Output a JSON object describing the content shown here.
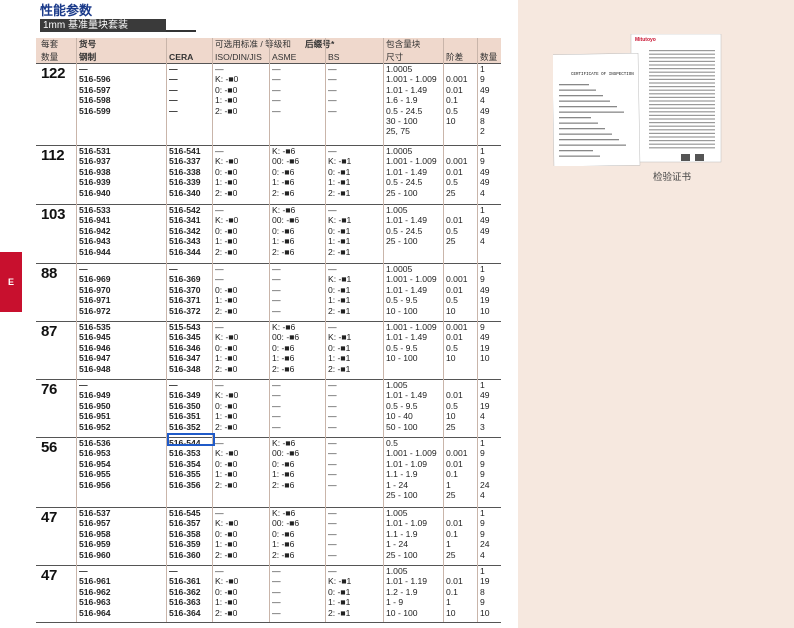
{
  "page": {
    "title": "性能参数",
    "subtitle": "1mm 基准量块套装",
    "tab_letter": "E",
    "cert_caption": "检验证书"
  },
  "colors": {
    "accent": "#c8102e",
    "title": "#1a3a8a",
    "side_bg": "#f6e8df",
    "header_bg": "#efd8cc",
    "highlight": "#1f5ac8"
  },
  "headers": {
    "top": [
      "每套",
      "货号",
      "可选用标准 / 等级和",
      "后缀号",
      "*",
      "包含量块"
    ],
    "bottom": [
      "数量",
      "钢制",
      "CERA",
      "ISO/DIN/JIS",
      "ASME",
      "BS",
      "尺寸",
      "阶差",
      "数量"
    ]
  },
  "groups": [
    {
      "qty": "122",
      "steel": [
        "—",
        "516-596",
        "516-597",
        "516-598",
        "516-599"
      ],
      "cera": [
        "—",
        "—",
        "—",
        "—",
        "—"
      ],
      "iso": [
        "—",
        "K: -■0",
        "0: -■0",
        "1: -■0",
        "2: -■0"
      ],
      "asme": [
        "—",
        "—",
        "—",
        "—",
        "—"
      ],
      "bs": [
        "—",
        "—",
        "—",
        "—",
        "—"
      ],
      "size": [
        "1.0005",
        "1.001 - 1.009",
        "1.01 - 1.49",
        "1.6 - 1.9",
        "0.5 - 24.5",
        "30 - 100",
        "25, 75"
      ],
      "step": [
        "",
        "0.001",
        "0.01",
        "0.1",
        "0.5",
        "10",
        ""
      ],
      "count": [
        "1",
        "9",
        "49",
        "4",
        "49",
        "8",
        "2"
      ]
    },
    {
      "qty": "112",
      "steel": [
        "516-531",
        "516-937",
        "516-938",
        "516-939",
        "516-940"
      ],
      "cera": [
        "516-541",
        "516-337",
        "516-338",
        "516-339",
        "516-340"
      ],
      "iso": [
        "—",
        "K: -■0",
        "0: -■0",
        "1: -■0",
        "2: -■0"
      ],
      "asme": [
        "K: -■6",
        "00: -■6",
        "0: -■6",
        "1: -■6",
        "2: -■6"
      ],
      "bs": [
        "—",
        "K: -■1",
        "0: -■1",
        "1: -■1",
        "2: -■1"
      ],
      "size": [
        "1.0005",
        "1.001 - 1.009",
        "1.01 - 1.49",
        "0.5 - 24.5",
        "25 - 100"
      ],
      "step": [
        "",
        "0.001",
        "0.01",
        "0.5",
        "25"
      ],
      "count": [
        "1",
        "9",
        "49",
        "49",
        "4"
      ]
    },
    {
      "qty": "103",
      "steel": [
        "516-533",
        "516-941",
        "516-942",
        "516-943",
        "516-944"
      ],
      "cera": [
        "516-542",
        "516-341",
        "516-342",
        "516-343",
        "516-344"
      ],
      "iso": [
        "—",
        "K: -■0",
        "0: -■0",
        "1: -■0",
        "2: -■0"
      ],
      "asme": [
        "K: -■6",
        "00: -■6",
        "0: -■6",
        "1: -■6",
        "2: -■6"
      ],
      "bs": [
        "—",
        "K: -■1",
        "0: -■1",
        "1: -■1",
        "2: -■1"
      ],
      "size": [
        "1.005",
        "1.01 - 1.49",
        "0.5 - 24.5",
        "25 - 100"
      ],
      "step": [
        "",
        "0.01",
        "0.5",
        "25"
      ],
      "count": [
        "1",
        "49",
        "49",
        "4"
      ]
    },
    {
      "qty": "88",
      "steel": [
        "—",
        "516-969",
        "516-970",
        "516-971",
        "516-972"
      ],
      "cera": [
        "—",
        "516-369",
        "516-370",
        "516-371",
        "516-372"
      ],
      "iso": [
        "—",
        "—",
        "0: -■0",
        "1: -■0",
        "2: -■0"
      ],
      "asme": [
        "—",
        "—",
        "—",
        "—",
        "—"
      ],
      "bs": [
        "—",
        "K: -■1",
        "0: -■1",
        "1: -■1",
        "2: -■1"
      ],
      "size": [
        "1.0005",
        "1.001 - 1.009",
        "1.01 - 1.49",
        "0.5 - 9.5",
        "10 - 100"
      ],
      "step": [
        "",
        "0.001",
        "0.01",
        "0.5",
        "10"
      ],
      "count": [
        "1",
        "9",
        "49",
        "19",
        "10"
      ]
    },
    {
      "qty": "87",
      "steel": [
        "516-535",
        "516-945",
        "516-946",
        "516-947",
        "516-948"
      ],
      "cera": [
        "515-543",
        "516-345",
        "516-346",
        "516-347",
        "516-348"
      ],
      "iso": [
        "—",
        "K: -■0",
        "0: -■0",
        "1: -■0",
        "2: -■0"
      ],
      "asme": [
        "K: -■6",
        "00: -■6",
        "0: -■6",
        "1: -■6",
        "2: -■6"
      ],
      "bs": [
        "—",
        "K: -■1",
        "0: -■1",
        "1: -■1",
        "2: -■1"
      ],
      "size": [
        "1.001 - 1.009",
        "1.01 - 1.49",
        "0.5 - 9.5",
        "10 - 100"
      ],
      "step": [
        "0.001",
        "0.01",
        "0.5",
        "10"
      ],
      "count": [
        "9",
        "49",
        "19",
        "10"
      ]
    },
    {
      "qty": "76",
      "steel": [
        "—",
        "516-949",
        "516-950",
        "516-951",
        "516-952"
      ],
      "cera": [
        "—",
        "516-349",
        "516-350",
        "516-351",
        "516-352"
      ],
      "iso": [
        "—",
        "K: -■0",
        "0: -■0",
        "1: -■0",
        "2: -■0"
      ],
      "asme": [
        "—",
        "—",
        "—",
        "—",
        "—"
      ],
      "bs": [
        "—",
        "—",
        "—",
        "—",
        "—"
      ],
      "size": [
        "1.005",
        "1.01 - 1.49",
        "0.5 - 9.5",
        "10 - 40",
        "50 - 100"
      ],
      "step": [
        "",
        "0.01",
        "0.5",
        "10",
        "25"
      ],
      "count": [
        "1",
        "49",
        "19",
        "4",
        "3"
      ]
    },
    {
      "qty": "56",
      "steel": [
        "516-536",
        "516-953",
        "516-954",
        "516-955",
        "516-956"
      ],
      "cera": [
        "516-544",
        "516-353",
        "516-354",
        "516-355",
        "516-356"
      ],
      "iso": [
        "—",
        "K: -■0",
        "0: -■0",
        "1: -■0",
        "2: -■0"
      ],
      "asme": [
        "K: -■6",
        "00: -■6",
        "0: -■6",
        "1: -■6",
        "2: -■6"
      ],
      "bs": [
        "—",
        "—",
        "—",
        "—",
        "—"
      ],
      "size": [
        "0.5",
        "1.001 - 1.009",
        "1.01 - 1.09",
        "1.1 - 1.9",
        "1 - 24",
        "25 - 100"
      ],
      "step": [
        "",
        "0.001",
        "0.01",
        "0.1",
        "1",
        "25"
      ],
      "count": [
        "1",
        "9",
        "9",
        "9",
        "24",
        "4"
      ]
    },
    {
      "qty": "47",
      "steel": [
        "516-537",
        "516-957",
        "516-958",
        "516-959",
        "516-960"
      ],
      "cera": [
        "516-545",
        "516-357",
        "516-358",
        "516-359",
        "516-360"
      ],
      "iso": [
        "—",
        "K: -■0",
        "0: -■0",
        "1: -■0",
        "2: -■0"
      ],
      "asme": [
        "K: -■6",
        "00: -■6",
        "0: -■6",
        "1: -■6",
        "2: -■6"
      ],
      "bs": [
        "—",
        "—",
        "—",
        "—",
        "—"
      ],
      "size": [
        "1.005",
        "1.01 - 1.09",
        "1.1 - 1.9",
        "1 - 24",
        "25 - 100"
      ],
      "step": [
        "",
        "0.01",
        "0.1",
        "1",
        "25"
      ],
      "count": [
        "1",
        "9",
        "9",
        "24",
        "4"
      ]
    },
    {
      "qty": "47",
      "steel": [
        "—",
        "516-961",
        "516-962",
        "516-963",
        "516-964"
      ],
      "cera": [
        "—",
        "516-361",
        "516-362",
        "516-363",
        "516-364"
      ],
      "iso": [
        "—",
        "K: -■0",
        "0: -■0",
        "1: -■0",
        "2: -■0"
      ],
      "asme": [
        "—",
        "—",
        "—",
        "—",
        "—"
      ],
      "bs": [
        "—",
        "K: -■1",
        "0: -■1",
        "1: -■1",
        "2: -■1"
      ],
      "size": [
        "1.005",
        "1.01 - 1.19",
        "1.2 - 1.9",
        "1 - 9",
        "10 - 100"
      ],
      "step": [
        "",
        "0.01",
        "0.1",
        "1",
        "10"
      ],
      "count": [
        "1",
        "19",
        "8",
        "9",
        "10"
      ]
    }
  ],
  "cert": {
    "brand": "Mitutoyo",
    "heading": "CERTIFICATE OF INSPECTION"
  }
}
